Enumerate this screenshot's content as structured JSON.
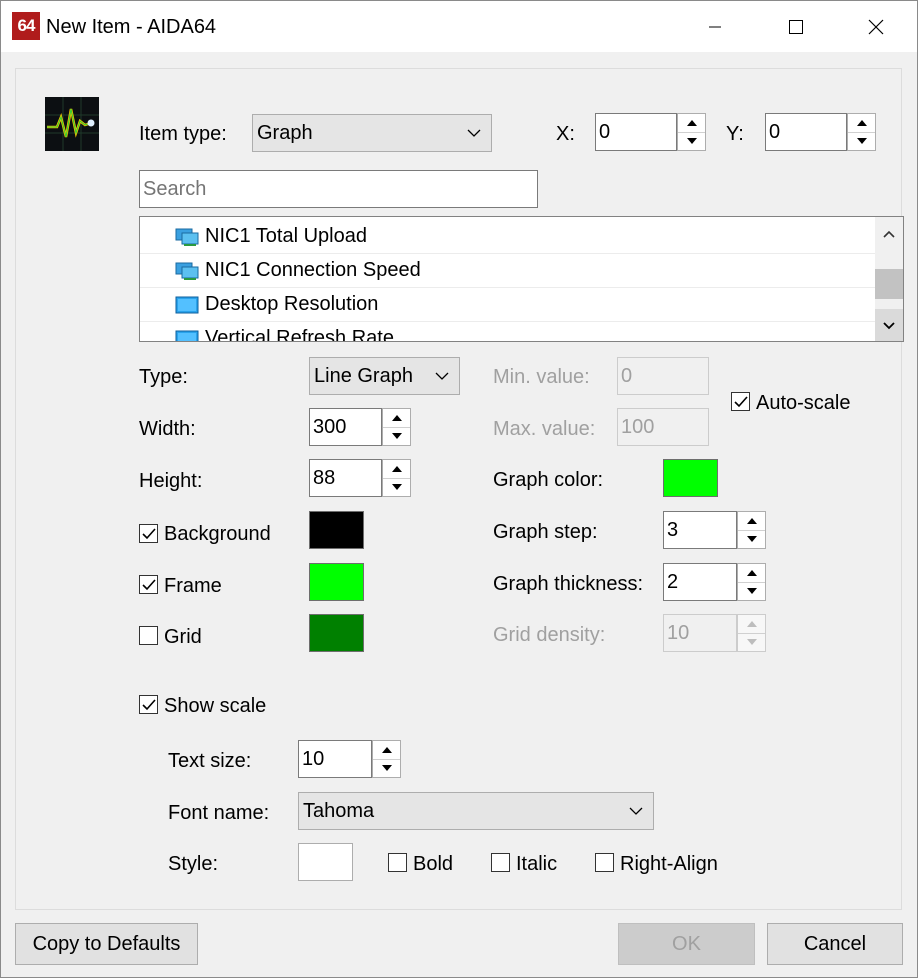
{
  "window": {
    "app_logo": "64",
    "title": "New Item - AIDA64",
    "controls": [
      "minimize-icon",
      "maximize-icon",
      "close-icon"
    ]
  },
  "item": {
    "item_type_label": "Item type:",
    "item_type_value": "Graph",
    "x_label": "X:",
    "x_value": "0",
    "y_label": "Y:",
    "y_value": "0"
  },
  "search": {
    "placeholder": "Search",
    "value": ""
  },
  "sensor_list": {
    "items": [
      {
        "label": "NIC1 Total Upload",
        "icon": "network-icon"
      },
      {
        "label": "NIC1 Connection Speed",
        "icon": "network-icon"
      },
      {
        "label": "Desktop Resolution",
        "icon": "monitor-icon"
      },
      {
        "label": "Vertical Refresh Rate",
        "icon": "monitor-icon"
      }
    ]
  },
  "graph": {
    "type_label": "Type:",
    "type_value": "Line Graph",
    "width_label": "Width:",
    "width_value": "300",
    "height_label": "Height:",
    "height_value": "88",
    "background_label": "Background",
    "background_checked": true,
    "background_color": "#000000",
    "frame_label": "Frame",
    "frame_checked": true,
    "frame_color": "#00ff00",
    "grid_label": "Grid",
    "grid_checked": false,
    "grid_color": "#008000",
    "min_label": "Min. value:",
    "min_value": "0",
    "max_label": "Max. value:",
    "max_value": "100",
    "autoscale_label": "Auto-scale",
    "autoscale_checked": true,
    "graph_color_label": "Graph color:",
    "graph_color": "#00ff00",
    "step_label": "Graph step:",
    "step_value": "3",
    "thickness_label": "Graph thickness:",
    "thickness_value": "2",
    "grid_density_label": "Grid density:",
    "grid_density_value": "10"
  },
  "scale": {
    "show_scale_label": "Show scale",
    "show_scale_checked": true,
    "text_size_label": "Text size:",
    "text_size_value": "10",
    "font_name_label": "Font name:",
    "font_name_value": "Tahoma",
    "style_label": "Style:",
    "style_color": "#ffffff",
    "bold_label": "Bold",
    "bold_checked": false,
    "italic_label": "Italic",
    "italic_checked": false,
    "right_align_label": "Right-Align",
    "right_align_checked": false
  },
  "footer": {
    "copy_defaults_label": "Copy to Defaults",
    "ok_label": "OK",
    "cancel_label": "Cancel"
  }
}
